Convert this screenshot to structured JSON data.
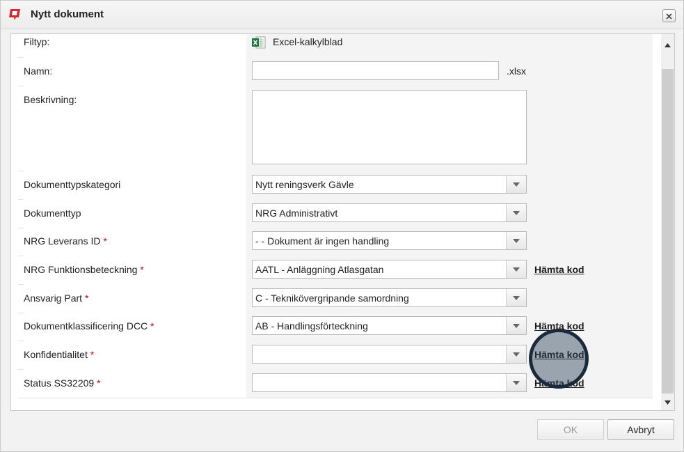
{
  "dialog": {
    "title": "Nytt dokument",
    "close_icon": "close-icon",
    "app_icon": "app-logo-icon"
  },
  "form": {
    "filetype": {
      "label": "Filtyp:",
      "value": "Excel-kalkylblad",
      "icon": "excel-file-icon"
    },
    "name": {
      "label": "Namn:",
      "value": "",
      "suffix": ".xlsx"
    },
    "description": {
      "label": "Beskrivning:",
      "value": ""
    },
    "fields": [
      {
        "label": "Dokumenttypskategori",
        "required": "",
        "value": "Nytt reningsverk Gävle",
        "link": ""
      },
      {
        "label": "Dokumenttyp",
        "required": "",
        "value": "NRG Administrativt",
        "link": ""
      },
      {
        "label": "NRG Leverans ID",
        "required": "*",
        "value": "- - Dokument är ingen handling",
        "link": ""
      },
      {
        "label": "NRG Funktionsbeteckning",
        "required": "*",
        "value": "AATL - Anläggning Atlasgatan",
        "link": "Hämta kod"
      },
      {
        "label": "Ansvarig Part",
        "required": "*",
        "value": "C - Teknikövergripande samordning",
        "link": ""
      },
      {
        "label": "Dokumentklassificering DCC",
        "required": "*",
        "value": "AB - Handlingsförteckning",
        "link": "Hämta kod"
      },
      {
        "label": "Konfidentialitet",
        "required": "*",
        "value": "",
        "link": "Hämta kod"
      },
      {
        "label": "Status SS32209",
        "required": "*",
        "value": "",
        "link": "Hämta kod"
      }
    ]
  },
  "buttons": {
    "ok": "OK",
    "cancel": "Avbryt"
  },
  "colors": {
    "required": "#d00000",
    "cursor_highlight": "#1a2a3a"
  }
}
